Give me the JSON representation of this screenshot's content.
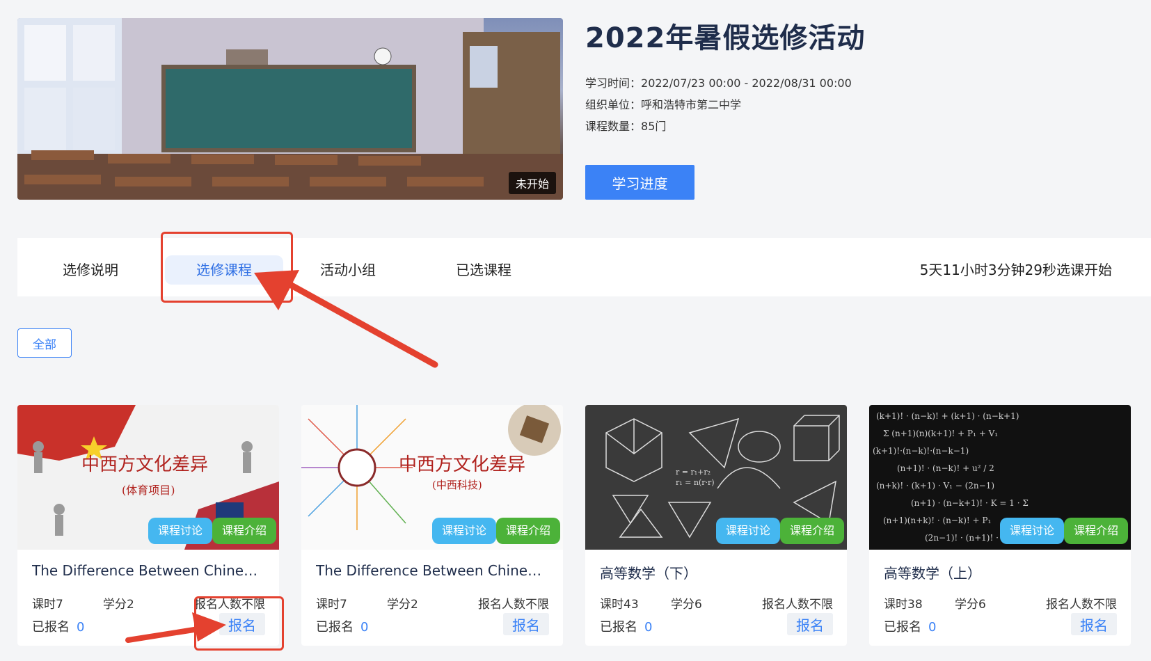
{
  "activity": {
    "title": "2022年暑假选修活动",
    "status_tag": "未开始",
    "study_time_label": "学习时间：",
    "study_time_value": "2022/07/23 00:00 - 2022/08/31 00:00",
    "org_label": "组织单位：",
    "org_value": "呼和浩特市第二中学",
    "course_count_label": "课程数量：",
    "course_count_value": "85门",
    "progress_button": "学习进度"
  },
  "tabs": {
    "items": [
      "选修说明",
      "选修课程",
      "活动小组",
      "已选课程"
    ],
    "active_index": 1,
    "countdown": "5天11小时3分钟29秒选课开始"
  },
  "filter": {
    "all_label": "全部"
  },
  "cards": [
    {
      "title": "The Difference Between Chines…",
      "hours": "课时7",
      "credits": "学分2",
      "limit": "报名人数不限",
      "enrolled_label": "已报名",
      "enrolled_count": "0",
      "signup": "报名",
      "discuss": "课程讨论",
      "intro": "课程介绍",
      "thumb_title": "中西方文化差异",
      "thumb_sub": "(体育项目)"
    },
    {
      "title": "The Difference Between Chines…",
      "hours": "课时7",
      "credits": "学分2",
      "limit": "报名人数不限",
      "enrolled_label": "已报名",
      "enrolled_count": "0",
      "signup": "报名",
      "discuss": "课程讨论",
      "intro": "课程介绍",
      "thumb_title": "中西方文化差异",
      "thumb_sub": "(中西科技)"
    },
    {
      "title": "高等数学（下）",
      "hours": "课时43",
      "credits": "学分6",
      "limit": "报名人数不限",
      "enrolled_label": "已报名",
      "enrolled_count": "0",
      "signup": "报名",
      "discuss": "课程讨论",
      "intro": "课程介绍"
    },
    {
      "title": "高等数学（上）",
      "hours": "课时38",
      "credits": "学分6",
      "limit": "报名人数不限",
      "enrolled_label": "已报名",
      "enrolled_count": "0",
      "signup": "报名",
      "discuss": "课程讨论",
      "intro": "课程介绍"
    }
  ],
  "colors": {
    "accent": "#3b82f6",
    "annotation": "#e4412f",
    "discuss_pill": "#45b7f0",
    "intro_pill": "#4cb239"
  }
}
